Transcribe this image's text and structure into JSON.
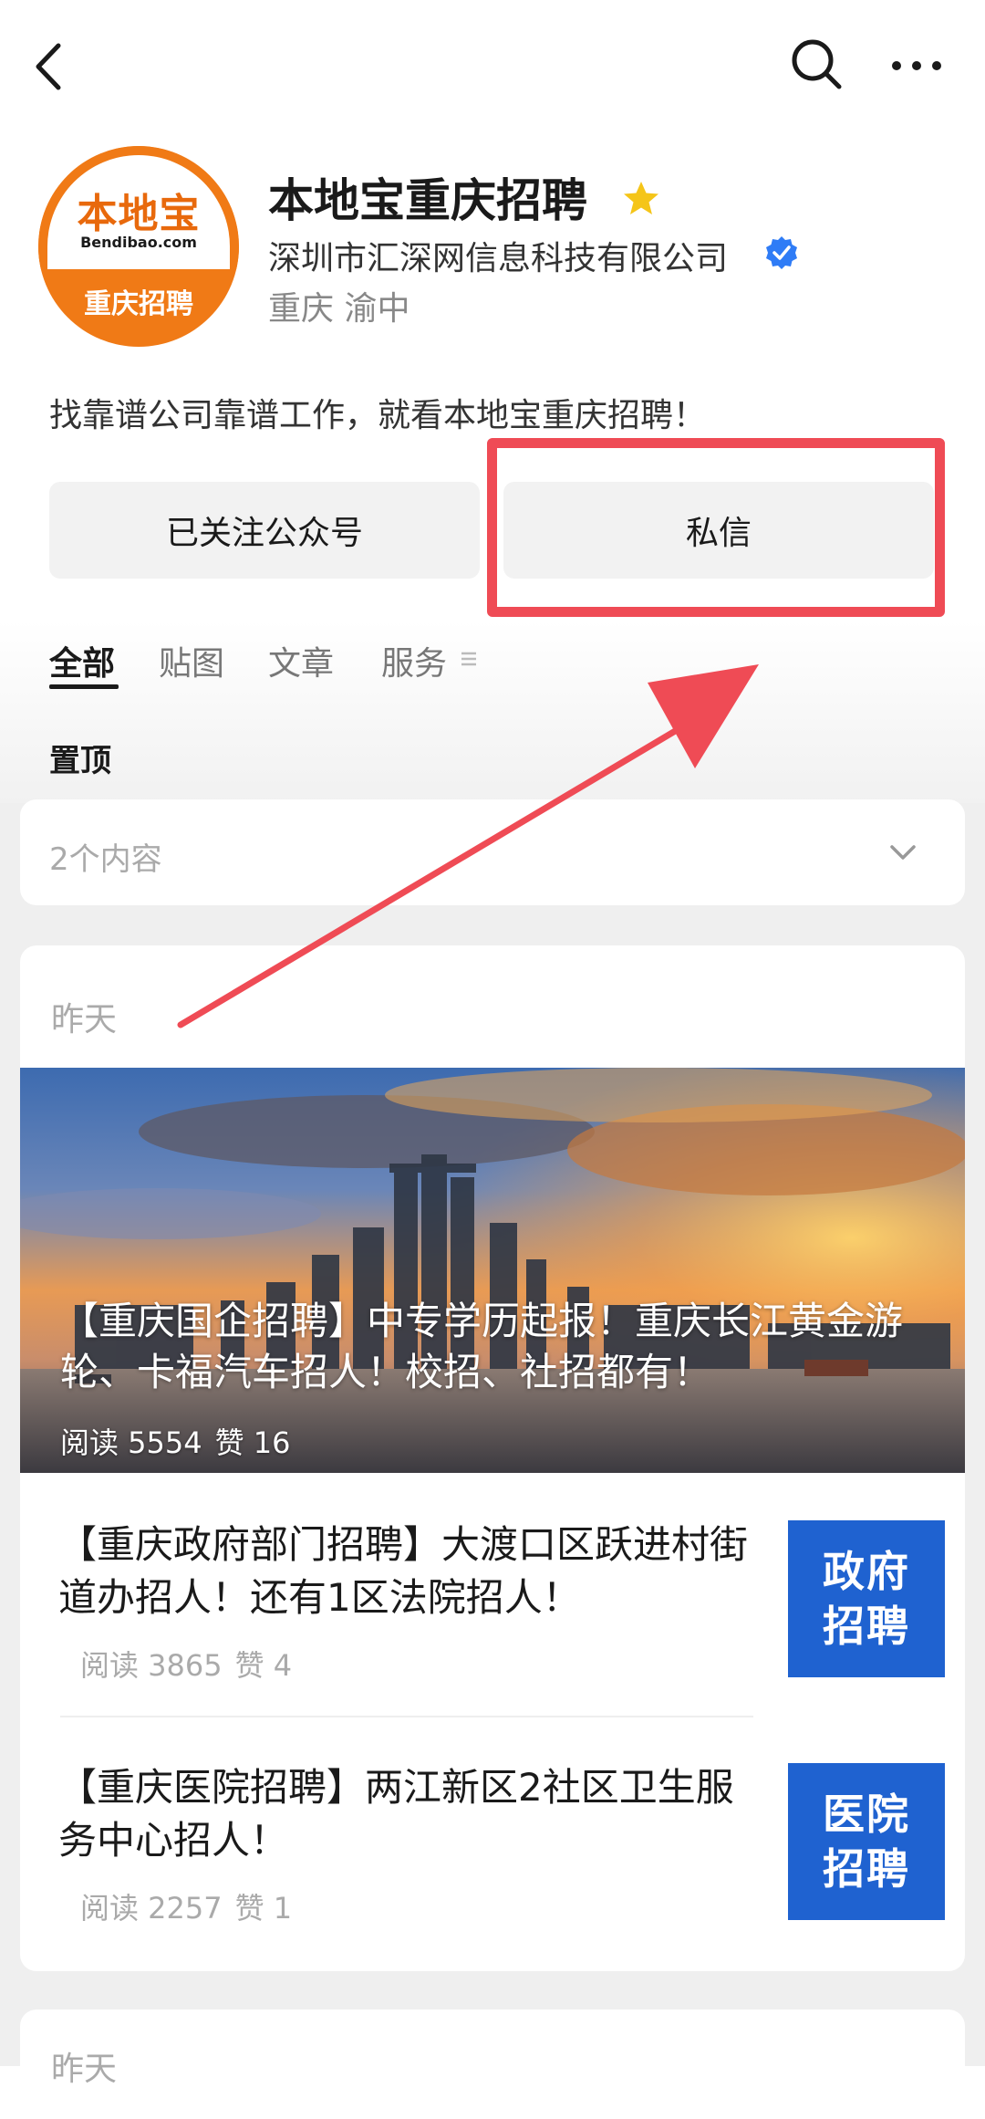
{
  "profile": {
    "avatar": {
      "brand_text": "本地宝",
      "domain_text": "Bendibao.com",
      "bottom_text": "重庆招聘"
    },
    "name": "本地宝重庆招聘",
    "company": "深圳市汇深网信息科技有限公司",
    "location": "重庆 渝中",
    "description": "找靠谱公司靠谱工作，就看本地宝重庆招聘！"
  },
  "actions": {
    "follow_label": "已关注公众号",
    "message_label": "私信"
  },
  "tabs": [
    {
      "label": "全部",
      "active": true
    },
    {
      "label": "贴图",
      "active": false
    },
    {
      "label": "文章",
      "active": false
    },
    {
      "label": "服务",
      "active": false
    }
  ],
  "pinned": {
    "title": "置顶",
    "count_text": "2个内容"
  },
  "feed": {
    "date": "昨天",
    "hero": {
      "title": "【重庆国企招聘】中专学历起报！重庆长江黄金游轮、卡福汽车招人！校招、社招都有！",
      "reads": "阅读 5554",
      "likes": "赞 16"
    },
    "articles": [
      {
        "title": "【重庆政府部门招聘】大渡口区跃进村街道办招人！还有1区法院招人！",
        "reads": "阅读 3865",
        "likes": "赞 4",
        "thumb_line1": "政府",
        "thumb_line2": "招聘"
      },
      {
        "title": "【重庆医院招聘】两江新区2社区卫生服务中心招人！",
        "reads": "阅读 2257",
        "likes": "赞 1",
        "thumb_line1": "医院",
        "thumb_line2": "招聘"
      }
    ],
    "next_date": "昨天"
  },
  "colors": {
    "annotation_red": "#ef4b55",
    "brand_orange": "#f07a16",
    "thumb_blue": "#1f62d0",
    "verified_blue": "#2f7cf6",
    "star_yellow": "#f5c518"
  }
}
